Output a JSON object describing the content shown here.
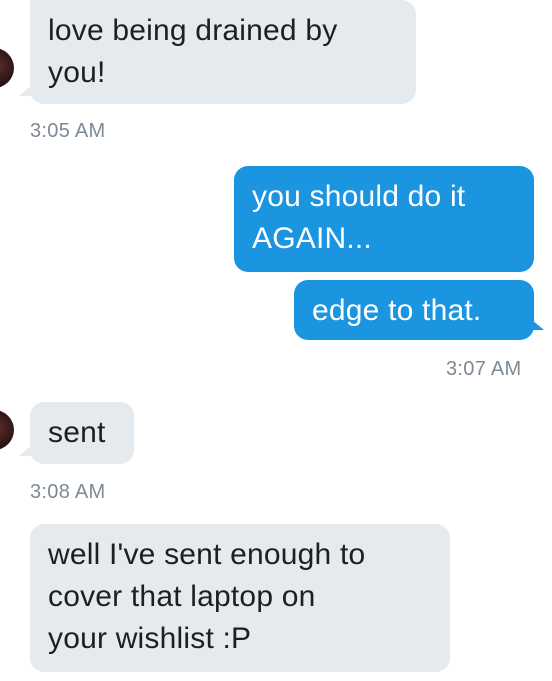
{
  "messages": [
    {
      "direction": "in",
      "text": "love being drained by\nyou!"
    },
    {
      "direction": "out",
      "text": "you should do it\nAGAIN..."
    },
    {
      "direction": "out",
      "text": "edge to that."
    },
    {
      "direction": "in",
      "text": "sent"
    },
    {
      "direction": "in",
      "text": "well I've sent enough to\ncover that laptop on\nyour wishlist :P"
    }
  ],
  "timestamps": [
    "3:05 AM",
    "3:07 AM",
    "3:08 AM"
  ],
  "colors": {
    "incoming_bubble": "#e5eaef",
    "outgoing_bubble": "#1b95e0",
    "timestamp": "#7d8a96"
  }
}
